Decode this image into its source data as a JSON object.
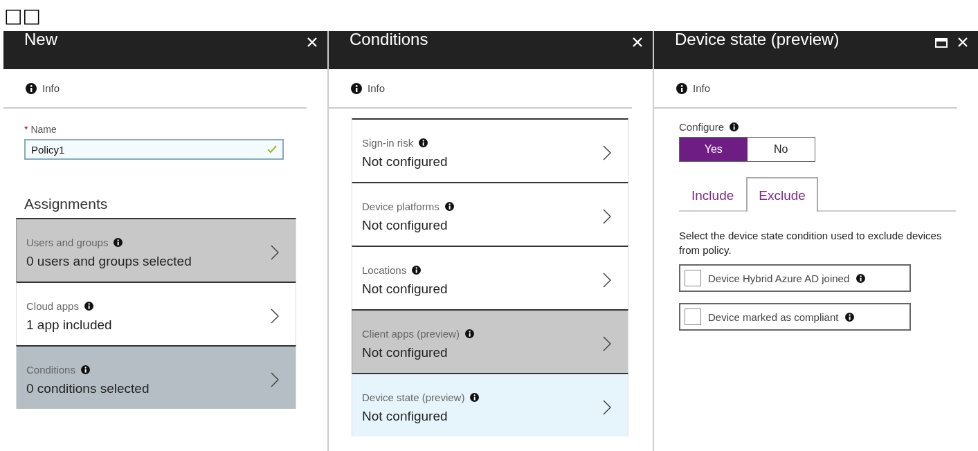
{
  "top_glyphs": "□□",
  "blades": [
    {
      "kind": "new",
      "title": "New",
      "maximize": false,
      "info": "Info",
      "name_field": {
        "label": "Name",
        "required_mark": "*",
        "value": "Policy1",
        "valid": true
      },
      "section": "Assignments",
      "items": [
        {
          "title": "Users and groups",
          "value": "0 users and groups selected",
          "highlighted": true,
          "selected": false
        },
        {
          "title": "Cloud apps",
          "value": "1 app included",
          "highlighted": false,
          "selected": false
        },
        {
          "title": "Conditions",
          "value": "0  conditions  selected",
          "highlighted": false,
          "selected": true
        }
      ]
    },
    {
      "kind": "conditions",
      "title": "Conditions",
      "maximize": false,
      "info": "Info",
      "items": [
        {
          "title": "Sign-in risk",
          "value": "Not configured",
          "highlighted": false,
          "selected": false
        },
        {
          "title": "Device platforms",
          "value": "Not configured",
          "highlighted": false,
          "selected": false
        },
        {
          "title": "Locations",
          "value": "Not configured",
          "highlighted": false,
          "selected": false
        },
        {
          "title": "Client apps (preview)",
          "value": "Not configured",
          "highlighted": true,
          "selected": false
        },
        {
          "title": "Device state (preview)",
          "value": "Not configured",
          "highlighted": false,
          "selected": true
        }
      ]
    },
    {
      "kind": "device",
      "title": "Device state (preview)",
      "maximize": true,
      "info": "Info",
      "configure": {
        "label": "Configure",
        "options": [
          {
            "label": "Yes",
            "selected": true
          },
          {
            "label": "No",
            "selected": false
          }
        ]
      },
      "tabs": [
        {
          "label": "Include",
          "selected": false
        },
        {
          "label": "Exclude",
          "selected": true
        }
      ],
      "description": "Select the device state condition used to exclude devices from policy.",
      "checkboxes": [
        {
          "label": "Device Hybrid Azure AD joined",
          "checked": false
        },
        {
          "label": "Device marked as compliant",
          "checked": false
        }
      ]
    }
  ]
}
